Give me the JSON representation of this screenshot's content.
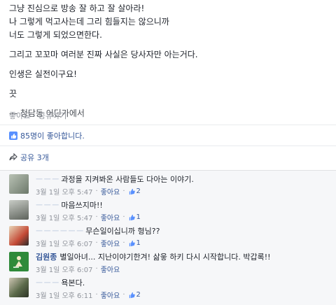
{
  "post": {
    "lines": [
      "그냥 진심으로 방송 잘 하고 잘 살아라!",
      "나 그렇게 먹고사는데 그리 힘들지는 않으니까",
      "너도 그렇게 되었으면한다."
    ],
    "line4": "그리고 꼬꼬마 여러분 진짜 사실은 당사자만 아는거다.",
    "line5": "인생은 실전이구요!",
    "line6": "끗",
    "signature": "— 청담동 어딘가에서"
  },
  "actions": {
    "like": "좋아요",
    "share": "공유하기",
    "dot": "·"
  },
  "summary": {
    "likes": "85명이 좋아합니다.",
    "shares": "공유 3개"
  },
  "comments": [
    {
      "name": "ㅡ ㅡ ㅡ",
      "text": "과정을 지켜봐온 사람들도 다아는 이야기.",
      "time": "3월 1일 오후 5:47",
      "like": "좋아요",
      "count": "2",
      "avatar_color": "#8a9a8a"
    },
    {
      "name": "ㅡ ㅡ ㅡ",
      "text": "마음쓰지마!!",
      "time": "3월 1일 오후 5:47",
      "like": "좋아요",
      "count": "1",
      "avatar_color": "#7b7f7a"
    },
    {
      "name": "ㅡ ㅡ ㅡ ㅡ ㅡ ㅡ",
      "text": "무슨일이십니까 형님??",
      "time": "3월 1일 오후 6:07",
      "like": "좋아요",
      "count": "1",
      "avatar_color": "#c44a36"
    },
    {
      "name": "김원종",
      "text": "별일아녀... 지난이야기한겨! 삶읗 하키 다시 시작합니다. 박갑록!!",
      "time": "3월 1일 오후 6:07",
      "like": "좋아요",
      "count": "",
      "avatar_color": "#2f8a3a"
    },
    {
      "name": "ㅡ ㅡ ㅡ",
      "text": "욕본다.",
      "time": "3월 1일 오후 6:11",
      "like": "좋아요",
      "count": "2",
      "avatar_color": "#5b6a4a"
    }
  ]
}
